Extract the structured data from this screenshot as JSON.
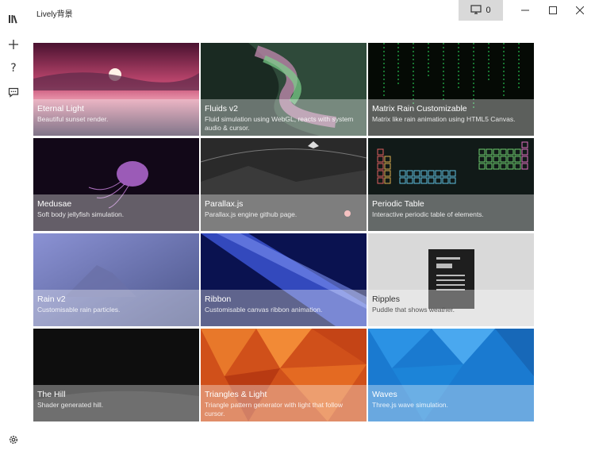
{
  "app": {
    "title": "Lively背景",
    "screen_count": "0"
  },
  "rail": {
    "items": [
      {
        "name": "library-icon"
      },
      {
        "name": "add-icon"
      },
      {
        "name": "help-icon"
      },
      {
        "name": "feedback-icon"
      },
      {
        "name": "settings-icon"
      }
    ]
  },
  "wallpapers": [
    {
      "title": "Eternal Light",
      "desc": "Beautiful sunset render."
    },
    {
      "title": "Fluids v2",
      "desc": "Fluid simulation using WebGL, reacts with system audio & cursor."
    },
    {
      "title": "Matrix Rain Customizable",
      "desc": "Matrix like rain animation using HTML5 Canvas."
    },
    {
      "title": "Medusae",
      "desc": "Soft body jellyfish simulation."
    },
    {
      "title": "Parallax.js",
      "desc": "Parallax.js engine github page."
    },
    {
      "title": "Periodic Table",
      "desc": "Interactive periodic table of elements."
    },
    {
      "title": "Rain v2",
      "desc": "Customisable rain particles."
    },
    {
      "title": "Ribbon",
      "desc": "Customisable canvas ribbon animation."
    },
    {
      "title": "Ripples",
      "desc": "Puddle that shows weather."
    },
    {
      "title": "The Hill",
      "desc": "Shader generated hill."
    },
    {
      "title": "Triangles & Light",
      "desc": "Triangle pattern generator with light that follow cursor."
    },
    {
      "title": "Waves",
      "desc": "Three.js wave simulation."
    }
  ]
}
